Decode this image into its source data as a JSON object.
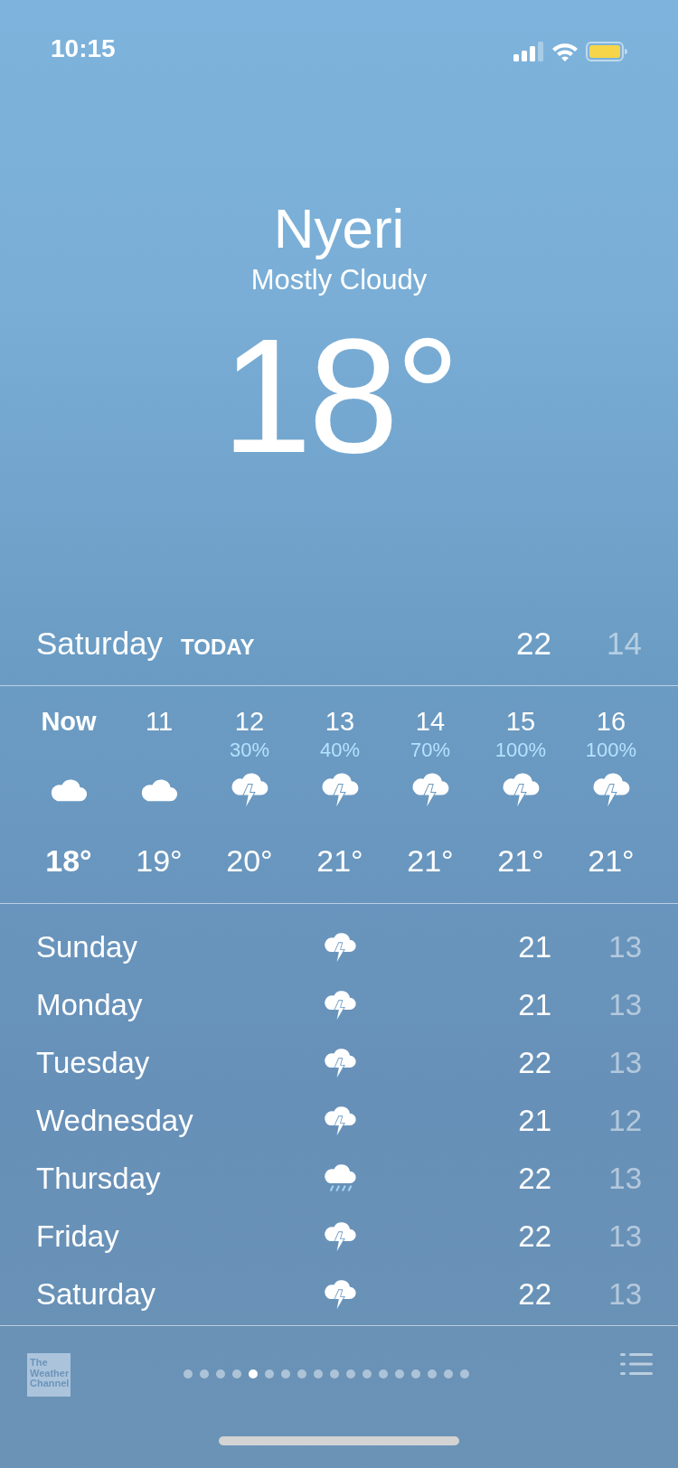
{
  "status_bar": {
    "time": "10:15"
  },
  "location": {
    "city": "Nyeri",
    "condition": "Mostly Cloudy",
    "temperature": "18°"
  },
  "today": {
    "day": "Saturday",
    "label": "TODAY",
    "high": "22",
    "low": "14"
  },
  "hourly": [
    {
      "hour": "Now",
      "kind": "cloud",
      "temp": "18°",
      "current": true
    },
    {
      "hour": "11",
      "kind": "cloud",
      "temp": "19°",
      "current": false
    },
    {
      "hour": "12",
      "chance": "30%",
      "kind": "thunderstorm",
      "temp": "20°",
      "current": false
    },
    {
      "hour": "13",
      "chance": "40%",
      "kind": "thunderstorm",
      "temp": "21°",
      "current": false
    },
    {
      "hour": "14",
      "chance": "70%",
      "kind": "thunderstorm",
      "temp": "21°",
      "current": false
    },
    {
      "hour": "15",
      "chance": "100%",
      "kind": "thunderstorm",
      "temp": "21°",
      "current": false
    },
    {
      "hour": "16",
      "chance": "100%",
      "kind": "thunderstorm",
      "temp": "21°",
      "current": false
    }
  ],
  "daily": [
    {
      "day": "Sunday",
      "kind": "thunderstorm",
      "high": "21",
      "low": "13"
    },
    {
      "day": "Monday",
      "kind": "thunderstorm",
      "high": "21",
      "low": "13"
    },
    {
      "day": "Tuesday",
      "kind": "thunderstorm",
      "high": "22",
      "low": "13"
    },
    {
      "day": "Wednesday",
      "kind": "thunderstorm",
      "high": "21",
      "low": "12"
    },
    {
      "day": "Thursday",
      "kind": "rain",
      "high": "22",
      "low": "13"
    },
    {
      "day": "Friday",
      "kind": "thunderstorm",
      "high": "22",
      "low": "13"
    },
    {
      "day": "Saturday",
      "kind": "thunderstorm",
      "high": "22",
      "low": "13"
    }
  ],
  "footer": {
    "logo": "The Weather Channel",
    "pages": [
      {
        "selected": false
      },
      {
        "selected": false
      },
      {
        "selected": false
      },
      {
        "selected": false
      },
      {
        "selected": true
      },
      {
        "selected": false
      },
      {
        "selected": false
      },
      {
        "selected": false
      },
      {
        "selected": false
      },
      {
        "selected": false
      },
      {
        "selected": false
      },
      {
        "selected": false
      },
      {
        "selected": false
      },
      {
        "selected": false
      },
      {
        "selected": false
      },
      {
        "selected": false
      },
      {
        "selected": false
      },
      {
        "selected": false
      }
    ]
  }
}
